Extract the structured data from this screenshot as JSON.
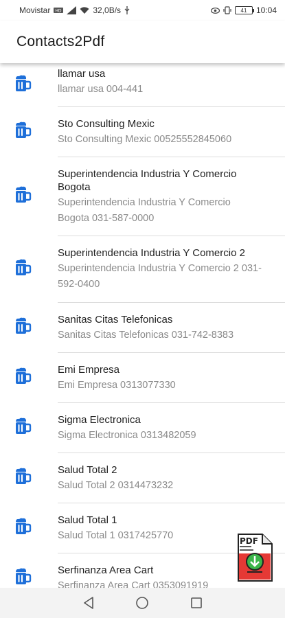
{
  "status_bar": {
    "carrier": "Movistar",
    "speed": "32,0B/s",
    "battery": "41",
    "time": "10:04"
  },
  "app": {
    "title": "Contacts2Pdf"
  },
  "contacts": [
    {
      "name": "llamar usa",
      "detail": "llamar usa 004-441"
    },
    {
      "name": "Sto Consulting Mexic",
      "detail": "Sto Consulting Mexic 00525552845060"
    },
    {
      "name": "Superintendencia Industria Y Comercio Bogota",
      "detail": "Superintendencia Industria Y Comercio Bogota 031-587-0000"
    },
    {
      "name": "Superintendencia Industria Y Comercio 2",
      "detail": "Superintendencia Industria Y Comercio 2 031-592-0400"
    },
    {
      "name": "Sanitas Citas Telefonicas",
      "detail": "Sanitas Citas Telefonicas 031-742-8383"
    },
    {
      "name": "Emi Empresa",
      "detail": "Emi Empresa 0313077330"
    },
    {
      "name": "Sigma Electronica",
      "detail": "Sigma Electronica 0313482059"
    },
    {
      "name": "Salud Total 2",
      "detail": "Salud Total 2 0314473232"
    },
    {
      "name": "Salud Total 1",
      "detail": "Salud Total 1 0317425770"
    },
    {
      "name": "Serfinanza Area Cart",
      "detail": "Serfinanza Area Cart 0353091919"
    }
  ],
  "fab": {
    "label": "PDF",
    "icon": "pdf-download-icon"
  },
  "icons": {
    "contact": "beer-mug-icon"
  },
  "colors": {
    "icon_blue": "#1e6fd9",
    "name_text": "#1f1f1f",
    "detail_text": "#8a8a8a",
    "pdf_red": "#e53935",
    "pdf_green": "#3bb54a"
  }
}
